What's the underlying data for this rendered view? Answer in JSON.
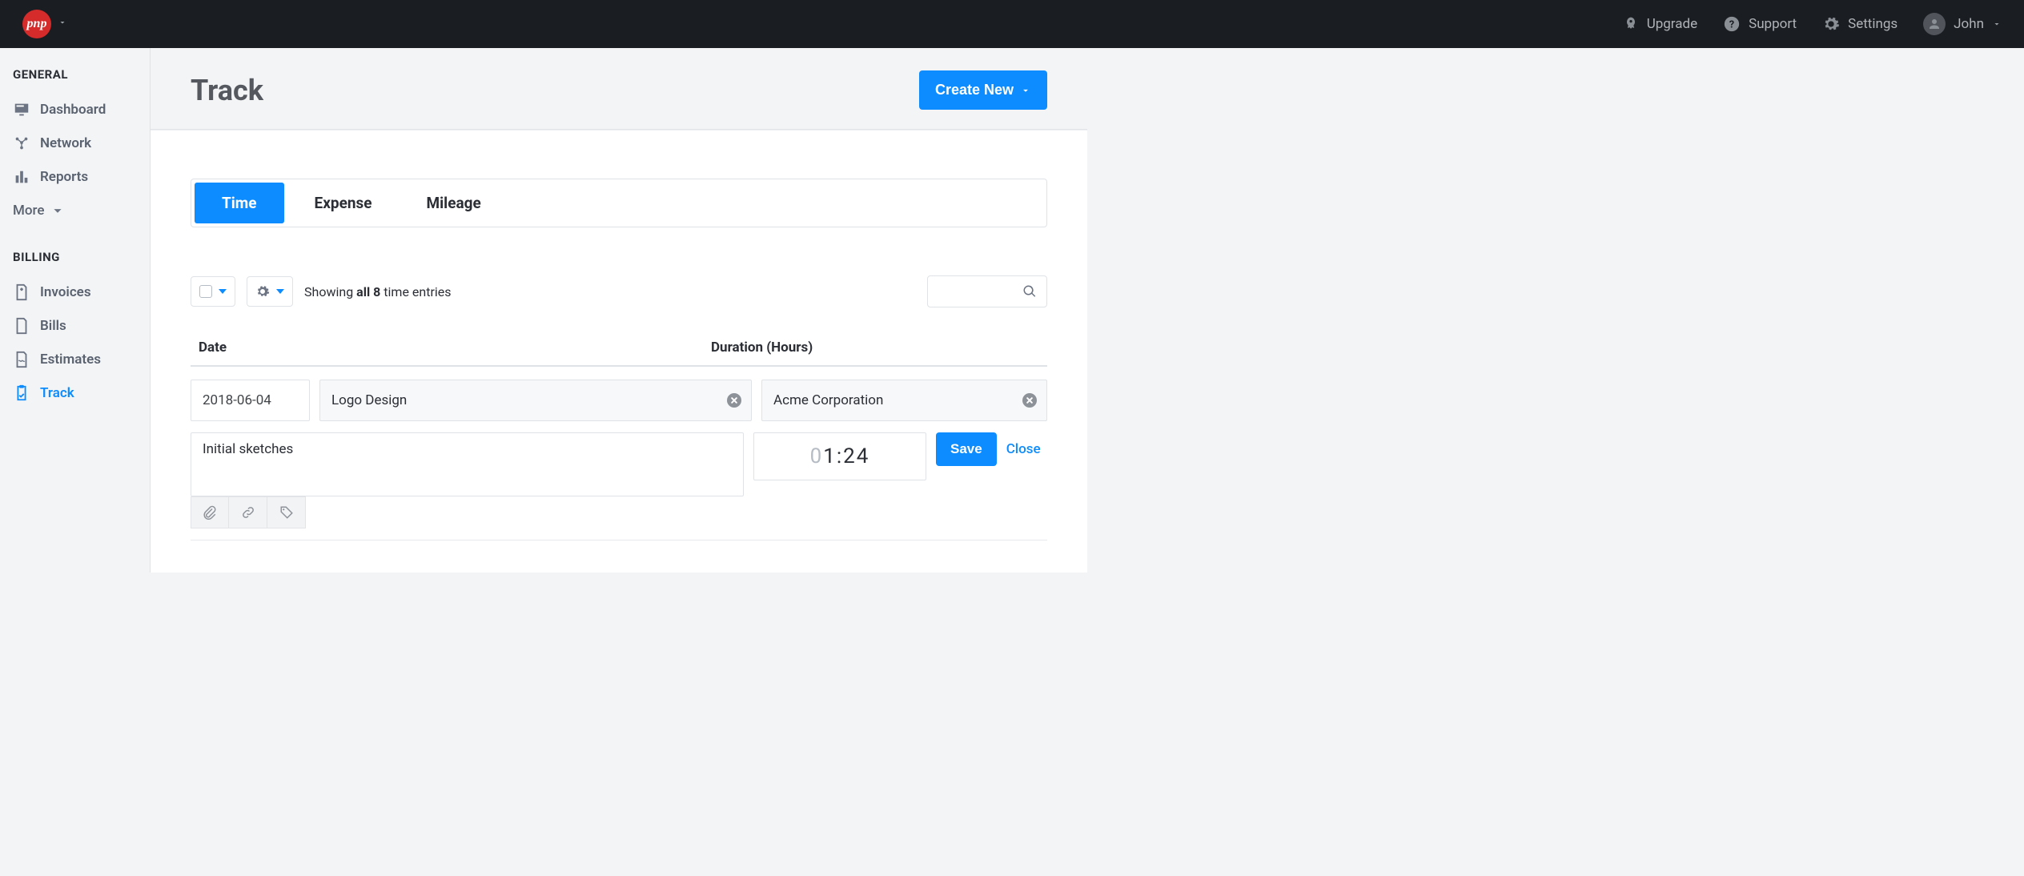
{
  "topbar": {
    "logo_text": "pnp",
    "items": {
      "upgrade": "Upgrade",
      "support": "Support",
      "settings": "Settings",
      "user": "John"
    }
  },
  "sidebar": {
    "section_general": "GENERAL",
    "section_billing": "BILLING",
    "general": [
      {
        "label": "Dashboard",
        "icon": "monitor"
      },
      {
        "label": "Network",
        "icon": "network"
      },
      {
        "label": "Reports",
        "icon": "bars"
      }
    ],
    "more_label": "More",
    "billing": [
      {
        "label": "Invoices",
        "icon": "file-plus"
      },
      {
        "label": "Bills",
        "icon": "file"
      },
      {
        "label": "Estimates",
        "icon": "file-wave"
      },
      {
        "label": "Track",
        "icon": "clipboard-check",
        "active": true
      }
    ]
  },
  "page": {
    "title": "Track",
    "create_label": "Create New"
  },
  "tabs": {
    "time": "Time",
    "expense": "Expense",
    "mileage": "Mileage",
    "active": "time"
  },
  "toolbar": {
    "showing_prefix": "Showing ",
    "showing_bold": "all 8",
    "showing_suffix": " time entries"
  },
  "columns": {
    "date": "Date",
    "duration": "Duration (Hours)"
  },
  "entry": {
    "date": "2018-06-04",
    "project": "Logo Design",
    "client": "Acme Corporation",
    "notes": "Initial sketches",
    "duration_prefix_zero": "0",
    "duration_value": "1:24",
    "save_label": "Save",
    "close_label": "Close"
  }
}
